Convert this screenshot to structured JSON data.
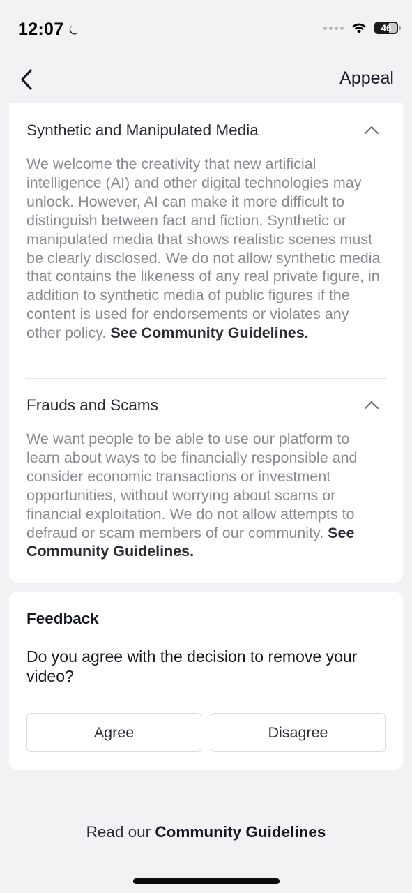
{
  "status_bar": {
    "time": "12:07",
    "battery_level": "46",
    "icons": [
      "moon-icon",
      "signal-dots-icon",
      "wifi-icon",
      "battery-icon"
    ]
  },
  "nav": {
    "back_icon": "chevron-left-icon",
    "title": "Appeal"
  },
  "policies": [
    {
      "title": "Synthetic and Manipulated Media",
      "body": "We welcome the creativity that new artificial intelligence (AI) and other digital technologies may unlock. However, AI can make it more difficult to distinguish between fact and fiction. Synthetic or manipulated media that shows realistic scenes must be clearly disclosed. We do not allow synthetic media that contains the likeness of any real private figure, in addition to synthetic media of public figures if the content is used for endorsements or violates any other policy.",
      "link": "See Community Guidelines.",
      "expanded_icon": "chevron-up-icon"
    },
    {
      "title": "Frauds and Scams",
      "body": "We want people to be able to use our platform to learn about ways to be financially responsible and consider economic transactions or investment opportunities, without worrying about scams or financial exploitation. We do not allow attempts to defraud or scam members of our community.",
      "link": "See Community Guidelines.",
      "expanded_icon": "chevron-up-icon"
    }
  ],
  "feedback": {
    "title": "Feedback",
    "question": "Do you agree with the decision to remove your video?",
    "agree_label": "Agree",
    "disagree_label": "Disagree"
  },
  "footer": {
    "prefix": "Read our",
    "link": "Community Guidelines"
  },
  "colors": {
    "background": "#f2f2f4",
    "card": "#ffffff",
    "body_text": "#8a8b91",
    "title_text": "#2b2c35"
  }
}
